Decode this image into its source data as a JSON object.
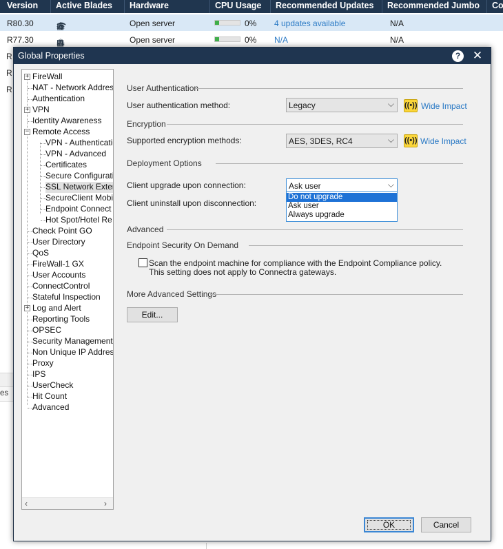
{
  "gateways": {
    "columns": [
      "Version",
      "Active Blades",
      "Hardware",
      "CPU Usage",
      "Recommended Updates",
      "Recommended Jumbo",
      "Co"
    ],
    "rows": [
      {
        "version": "R80.30",
        "hardware": "Open server",
        "cpu": "0%",
        "cpu_fraction": 0.0,
        "updates": "4 updates available",
        "jumbo": "N/A"
      },
      {
        "version": "R77.30",
        "hardware": "Open server",
        "cpu": "0%",
        "cpu_fraction": 0.0,
        "updates": "N/A",
        "jumbo": "N/A"
      }
    ],
    "hidden_row_fragments": [
      "R",
      "R",
      "R"
    ],
    "bottom_fragment": "es"
  },
  "dialog": {
    "title": "Global Properties",
    "help": "?",
    "close": "✕",
    "tree": [
      {
        "label": "FireWall",
        "expander": "+"
      },
      {
        "label": "NAT - Network Addres"
      },
      {
        "label": "Authentication"
      },
      {
        "label": "VPN",
        "expander": "+"
      },
      {
        "label": "Identity Awareness"
      },
      {
        "label": "Remote Access",
        "expander": "−"
      },
      {
        "label": "VPN - Authenticatio"
      },
      {
        "label": "VPN - Advanced"
      },
      {
        "label": "Certificates"
      },
      {
        "label": "Secure Configurati"
      },
      {
        "label": "SSL Network Exter"
      },
      {
        "label": "SecureClient Mobil"
      },
      {
        "label": "Endpoint Connect"
      },
      {
        "label": "Hot Spot/Hotel Re"
      },
      {
        "label": "Check Point GO"
      },
      {
        "label": "User Directory"
      },
      {
        "label": "QoS"
      },
      {
        "label": "FireWall-1 GX"
      },
      {
        "label": "User Accounts"
      },
      {
        "label": "ConnectControl"
      },
      {
        "label": "Stateful Inspection"
      },
      {
        "label": "Log and Alert",
        "expander": "+"
      },
      {
        "label": "Reporting Tools"
      },
      {
        "label": "OPSEC"
      },
      {
        "label": "Security Management A"
      },
      {
        "label": "Non Unique IP Address"
      },
      {
        "label": "Proxy"
      },
      {
        "label": "IPS"
      },
      {
        "label": "UserCheck"
      },
      {
        "label": "Hit Count"
      },
      {
        "label": "Advanced"
      }
    ],
    "selected_tree_item": "SSL Network Exter",
    "scroll_left": "‹",
    "scroll_right": "›",
    "sections": {
      "user_auth": "User Authentication",
      "encryption": "Encryption",
      "deployment": "Deployment Options",
      "advanced": "Advanced",
      "endpoint": "Endpoint Security On Demand",
      "more": "More Advanced Settings"
    },
    "fields": {
      "auth_method_label": "User authentication method:",
      "auth_method_value": "Legacy",
      "enc_label": "Supported encryption methods:",
      "enc_value": "AES, 3DES, RC4",
      "upgrade_label": "Client upgrade upon connection:",
      "upgrade_value": "Ask user",
      "uninstall_label": "Client uninstall upon disconnection:",
      "upgrade_options": [
        "Do not upgrade",
        "Ask user",
        "Always upgrade"
      ],
      "upgrade_highlighted": "Do not upgrade",
      "wide_impact": "Wide Impact",
      "scan_label_1": "Scan the endpoint machine for compliance with the Endpoint Compliance policy.",
      "scan_label_2": "This setting does not apply to Connectra gateways.",
      "scan_checked": false,
      "edit_button": "Edit...",
      "ok_button": "OK",
      "cancel_button": "Cancel"
    }
  },
  "colors": {
    "header_bg": "#20364f",
    "title_bg": "#1f3550",
    "link": "#2b7ac5",
    "selection": "#d9e8f6",
    "dropdown_highlight": "#1e72d6",
    "impact_yellow": "#fbd63a"
  }
}
